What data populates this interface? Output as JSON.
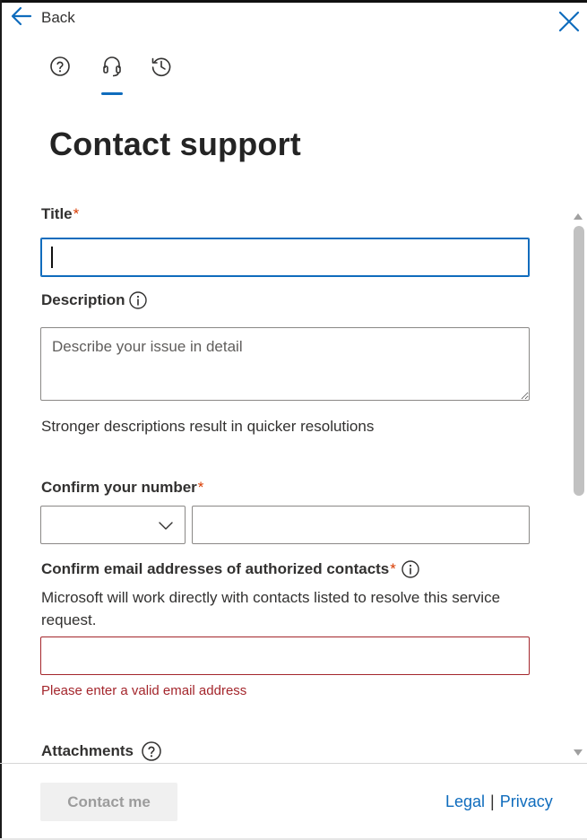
{
  "header": {
    "back_label": "Back",
    "back_icon": "arrow-left-icon",
    "close_icon": "close-icon",
    "tabs": [
      {
        "icon": "help-question-icon",
        "active": false
      },
      {
        "icon": "headset-icon",
        "active": true
      },
      {
        "icon": "history-icon",
        "active": false
      }
    ]
  },
  "page": {
    "title": "Contact support"
  },
  "form": {
    "title_field": {
      "label": "Title",
      "required_mark": "*",
      "value": ""
    },
    "description_field": {
      "label": "Description",
      "placeholder": "Describe your issue in detail",
      "helper": "Stronger descriptions result in quicker resolutions"
    },
    "phone_field": {
      "label": "Confirm your number",
      "required_mark": "*",
      "country_value": "",
      "number_value": ""
    },
    "email_field": {
      "label": "Confirm email addresses of authorized contacts",
      "required_mark": "*",
      "helper": "Microsoft will work directly with contacts listed to resolve this service request.",
      "value": "",
      "error": "Please enter a valid email address"
    },
    "attachments": {
      "label": "Attachments"
    }
  },
  "footer": {
    "submit_label": "Contact me",
    "legal_label": "Legal",
    "separator": "|",
    "privacy_label": "Privacy"
  },
  "colors": {
    "accent": "#0f6cbd",
    "required": "#d83b01",
    "error": "#a4262c",
    "disabled_bg": "#f0f0f0",
    "disabled_text": "#9c9c9c"
  }
}
